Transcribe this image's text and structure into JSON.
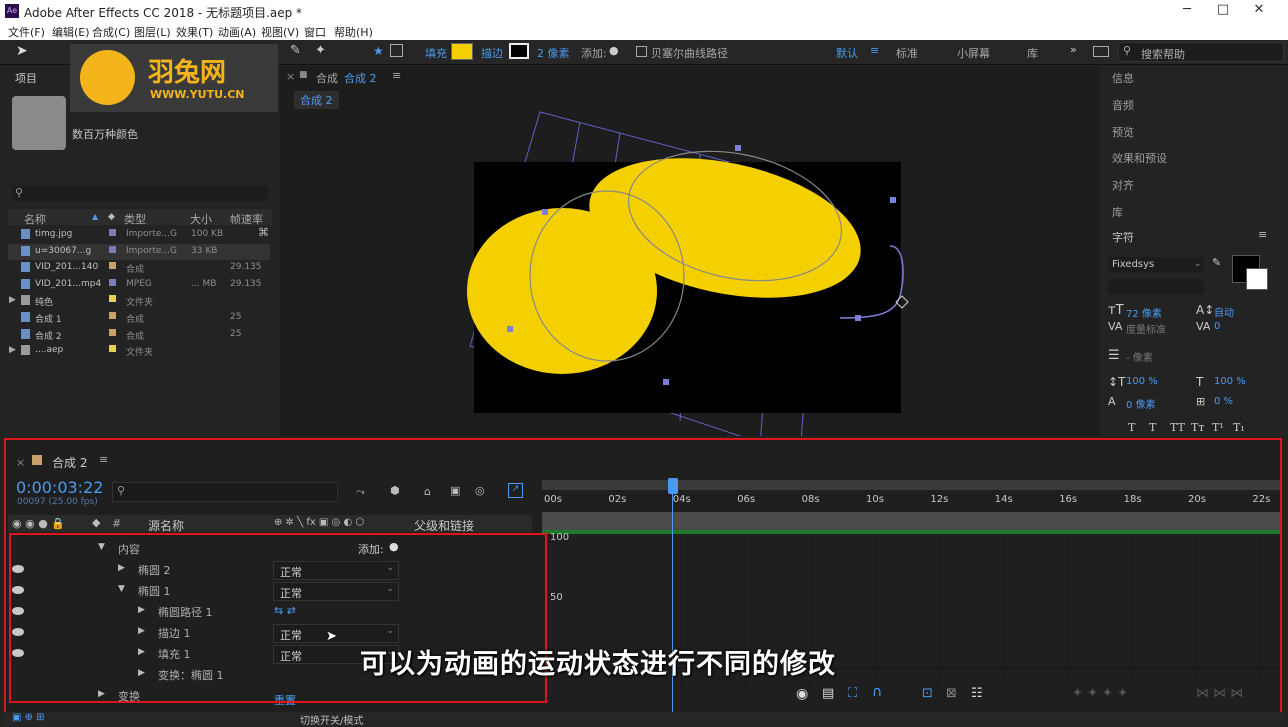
{
  "window": {
    "title": "Adobe After Effects CC 2018 - 无标题项目.aep *",
    "app_icon": "Ae"
  },
  "menu": [
    "文件(F)",
    "编辑(E)",
    "合成(C)",
    "图层(L)",
    "效果(T)",
    "动画(A)",
    "视图(V)",
    "窗口",
    "帮助(H)"
  ],
  "toolbar": {
    "fill_label": "填充",
    "fill_color": "#f5d000",
    "stroke_label": "描边",
    "stroke_width": "2 像素",
    "add_label": "添加:",
    "bezier_label": "贝塞尔曲线路径",
    "workspaces": [
      "默认",
      "标准",
      "小屏幕",
      "库"
    ],
    "search_placeholder": "搜索帮助"
  },
  "watermark": {
    "name": "羽兔网",
    "url": "WWW.YUTU.CN"
  },
  "project": {
    "tab": "项目",
    "thumb_info": "数百万种颜色",
    "columns": [
      "名称",
      "类型",
      "大小",
      "帧速率"
    ],
    "items": [
      {
        "name": "timg.jpg",
        "type": "Importe...G",
        "size": "100 KB",
        "fps": "",
        "color": "#7d7db6",
        "icon": "file-icon"
      },
      {
        "name": "u=30067...g",
        "type": "Importe...G",
        "size": "33 KB",
        "fps": "",
        "color": "#7d7db6",
        "icon": "file-icon"
      },
      {
        "name": "VID_201...140",
        "type": "合成",
        "size": "",
        "fps": "29.135",
        "color": "#c7a06b",
        "icon": "comp-icon"
      },
      {
        "name": "VID_201...mp4",
        "type": "MPEG",
        "size": "... MB",
        "fps": "29.135",
        "color": "#7d7db6",
        "icon": "file-icon"
      },
      {
        "name": "纯色",
        "type": "文件夹",
        "size": "",
        "fps": "",
        "color": "#e8d24a",
        "icon": "folder-icon"
      },
      {
        "name": "合成 1",
        "type": "合成",
        "size": "",
        "fps": "25",
        "color": "#c7a06b",
        "icon": "comp-icon"
      },
      {
        "name": "合成 2",
        "type": "合成",
        "size": "",
        "fps": "25",
        "color": "#c7a06b",
        "icon": "comp-icon"
      },
      {
        "name": "....aep",
        "type": "文件夹",
        "size": "",
        "fps": "",
        "color": "#e8d24a",
        "icon": "folder-icon"
      }
    ]
  },
  "composition": {
    "tab_prefix": "合成",
    "tab_name": "合成 2",
    "flow": "合成 2"
  },
  "right_panel": {
    "items": [
      "信息",
      "音频",
      "预览",
      "效果和预设",
      "对齐",
      "库"
    ],
    "character_label": "字符",
    "font": "Fixedsys",
    "font_size": "72 像素",
    "leading": "自动",
    "kerning": "度量标准",
    "tracking": "0",
    "stroke_width": "- 像素",
    "v_scale": "100 %",
    "h_scale": "100 %",
    "baseline": "0 像素",
    "tsume": "0 %",
    "styles": [
      "T",
      "T",
      "TT",
      "Tт",
      "T¹",
      "T₁"
    ]
  },
  "timeline": {
    "tab": "合成 2",
    "timecode": "0:00:03:22",
    "frames": "00097 (25.00 fps)",
    "col_source": "源名称",
    "col_parent": "父级和链接",
    "ruler": [
      "00s",
      "02s",
      "04s",
      "06s",
      "08s",
      "10s",
      "12s",
      "14s",
      "16s",
      "18s",
      "20s",
      "22s"
    ],
    "graph_values": [
      "100",
      "50"
    ],
    "layers": [
      {
        "label": "内容",
        "indent": 1,
        "arrow": "▼",
        "extra": "添加:",
        "dropdown": "",
        "eye": false
      },
      {
        "label": "椭圆 2",
        "indent": 2,
        "arrow": "▶",
        "extra": "",
        "dropdown": "正常",
        "eye": true
      },
      {
        "label": "椭圆 1",
        "indent": 2,
        "arrow": "▼",
        "extra": "",
        "dropdown": "正常",
        "eye": true
      },
      {
        "label": "椭圆路径 1",
        "indent": 3,
        "arrow": "▶",
        "extra": "",
        "dropdown": "",
        "eye": true
      },
      {
        "label": "描边 1",
        "indent": 3,
        "arrow": "▶",
        "extra": "",
        "dropdown": "正常",
        "eye": true
      },
      {
        "label": "填充 1",
        "indent": 3,
        "arrow": "▶",
        "extra": "",
        "dropdown": "正常",
        "eye": true
      },
      {
        "label": "变换：椭圆 1",
        "indent": 3,
        "arrow": "▶",
        "extra": "",
        "dropdown": "",
        "eye": false
      },
      {
        "label": "变换",
        "indent": 1,
        "arrow": "▶",
        "extra": "",
        "dropdown": "",
        "eye": false
      }
    ],
    "reset_label": "重置",
    "mode_label": "切换开关/模式"
  },
  "subtitle": "可以为动画的运动状态进行不同的修改",
  "colors": {
    "accent": "#2d8ceb",
    "highlight": "#e0141c",
    "ellipse": "#f5d000"
  }
}
